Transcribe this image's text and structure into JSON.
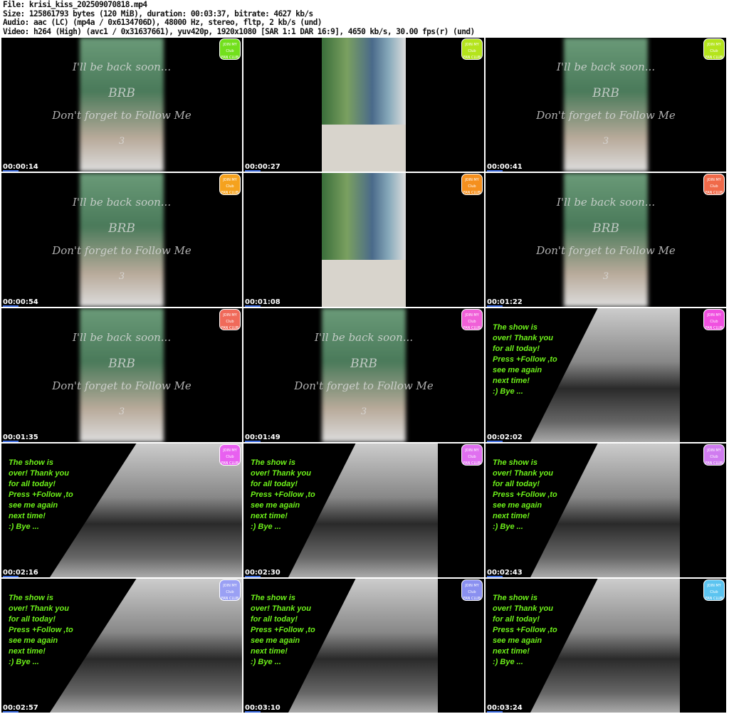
{
  "header": {
    "lines": [
      "File: krisi_kiss_202509070818.mp4",
      "Size: 125861793 bytes (120 MiB), duration: 00:03:37, bitrate: 4627 kb/s",
      "Audio: aac (LC) (mp4a / 0x6134706D), 48000 Hz, stereo, fltp, 2 kb/s (und)",
      "Video: h264 (High) (avc1 / 0x31637661), yuv420p, 1920x1080 [SAR 1:1 DAR 16:9], 4650 kb/s, 30.00 fps(r) (und)"
    ]
  },
  "overlay": {
    "brb": [
      "I'll be back soon...",
      "BRB",
      "Don't forget to Follow Me",
      "3"
    ],
    "end": "The show is\nover! Thank you\nfor all today!\nPress +Follow ,to\nsee me again\nnext time!\n:) Bye ...",
    "badge": "JOIN MY\nClub\nFAN CLUB"
  },
  "thumbnails": [
    {
      "time": "00:00:14",
      "type": "brb",
      "badge_color": "#72e01c"
    },
    {
      "time": "00:00:27",
      "type": "photo",
      "badge_color": "#b4e41c"
    },
    {
      "time": "00:00:41",
      "type": "brb",
      "badge_color": "#b4e41c"
    },
    {
      "time": "00:00:54",
      "type": "brb",
      "badge_color": "#f5a21e"
    },
    {
      "time": "00:01:08",
      "type": "photo",
      "badge_color": "#f5901e"
    },
    {
      "time": "00:01:22",
      "type": "brb",
      "badge_color": "#f06a4a"
    },
    {
      "time": "00:01:35",
      "type": "brb",
      "badge_color": "#f06a5a"
    },
    {
      "time": "00:01:49",
      "type": "brb",
      "badge_color": "#f060d8"
    },
    {
      "time": "00:02:02",
      "type": "endright",
      "badge_color": "#f050e0"
    },
    {
      "time": "00:02:16",
      "type": "end",
      "badge_color": "#e860f0"
    },
    {
      "time": "00:02:30",
      "type": "endright",
      "badge_color": "#e070f0"
    },
    {
      "time": "00:02:43",
      "type": "endright",
      "badge_color": "#d07cf0"
    },
    {
      "time": "00:02:57",
      "type": "end",
      "badge_color": "#9aa0f4"
    },
    {
      "time": "00:03:10",
      "type": "endright",
      "badge_color": "#8a90f0"
    },
    {
      "time": "00:03:24",
      "type": "endright",
      "badge_color": "#5cc4f0"
    }
  ]
}
